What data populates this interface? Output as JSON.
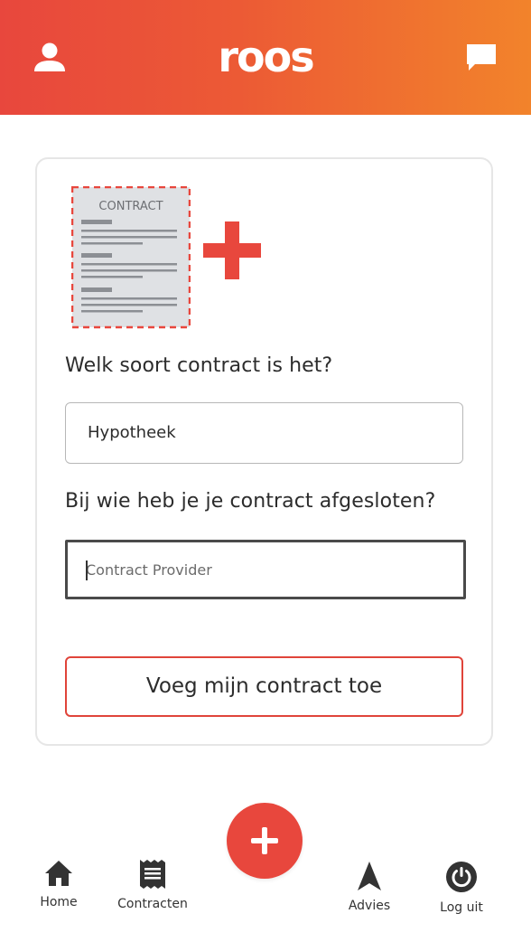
{
  "header": {
    "logo_text": "roos",
    "left_icon": "user-icon",
    "right_icon": "chat-icon",
    "gradient_start": "#e8473d",
    "gradient_end": "#f2832b"
  },
  "illustration": {
    "contract_label": "CONTRACT",
    "accent_color": "#e8473d"
  },
  "form": {
    "question_type": "Welk soort contract is het?",
    "type_value": "Hypotheek",
    "question_provider": "Bij wie heb je je contract afgesloten?",
    "provider_placeholder": "Contract Provider",
    "provider_value": "",
    "submit_label": "Voeg mijn contract toe"
  },
  "fab": {
    "icon": "plus-icon",
    "color": "#e8473d"
  },
  "bottom_nav": {
    "items": [
      {
        "label": "Home",
        "icon": "home-icon"
      },
      {
        "label": "Contracten",
        "icon": "receipt-icon"
      },
      {
        "label": "Advies",
        "icon": "navigation-arrow-icon"
      },
      {
        "label": "Log uit",
        "icon": "power-icon"
      }
    ]
  }
}
